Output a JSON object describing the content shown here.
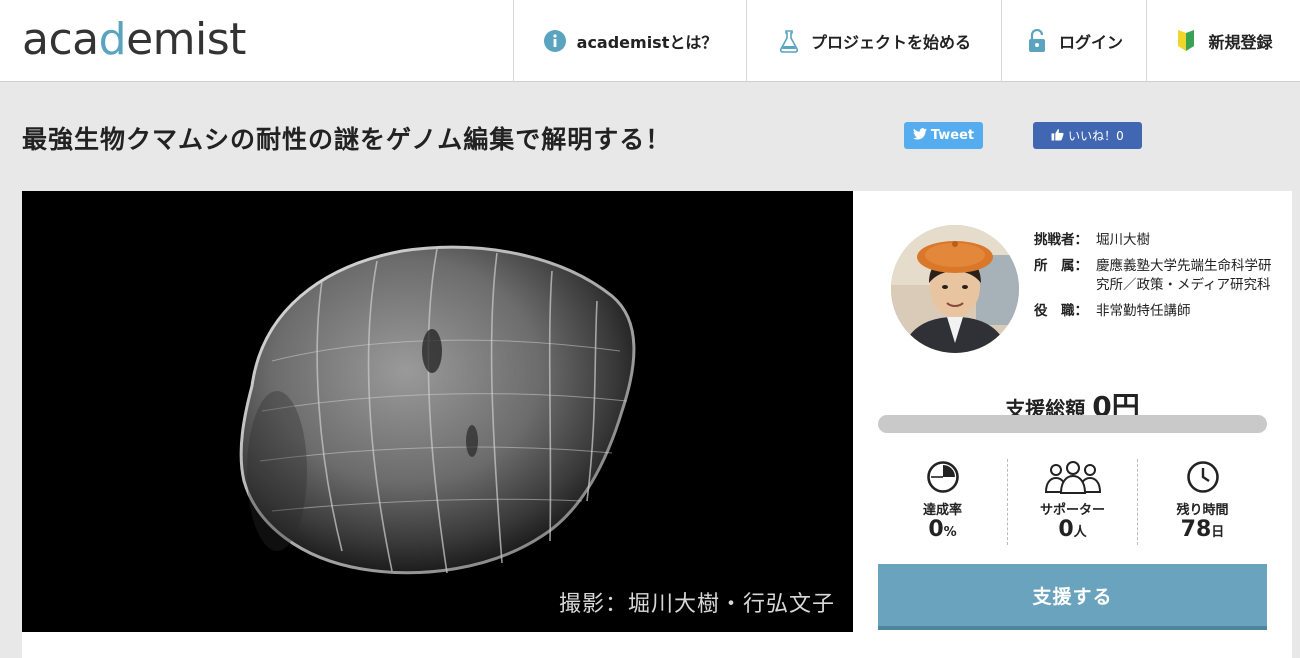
{
  "header": {
    "logo_prefix": "aca",
    "logo_dot": "d",
    "logo_suffix": "emist",
    "nav": [
      {
        "label": "academistとは？",
        "icon": "info-icon"
      },
      {
        "label": "プロジェクトを始める",
        "icon": "flask-icon"
      },
      {
        "label": "ログイン",
        "icon": "lock-icon"
      },
      {
        "label": "新規登録",
        "icon": "beginner-mark-icon"
      }
    ]
  },
  "project": {
    "title": "最強生物クマムシの耐性の謎をゲノム編集で解明する！",
    "image_caption": "撮影：堀川大樹・行弘文子"
  },
  "social": {
    "tweet_label": "Tweet",
    "like_label": "いいね！0"
  },
  "researcher": {
    "rows": [
      {
        "key": "挑戦者：",
        "value": "堀川大樹"
      },
      {
        "key": "所　属：",
        "value": "慶應義塾大学先端生命科学研究所／政策・メディア研究科"
      },
      {
        "key": "役　職：",
        "value": "非常勤特任講師"
      }
    ]
  },
  "funding": {
    "total_label": "支援総額",
    "total_amount": "0円",
    "progress_percent": 0
  },
  "stats": [
    {
      "label": "達成率",
      "value": "0",
      "unit": "%",
      "icon": "pie-chart-icon"
    },
    {
      "label": "サポーター",
      "value": "0",
      "unit": "人",
      "icon": "supporters-icon"
    },
    {
      "label": "残り時間",
      "value": "78",
      "unit": "日",
      "icon": "clock-icon"
    }
  ],
  "support_button": "支援する",
  "colors": {
    "accent": "#6aa3bd",
    "twitter": "#55acee",
    "facebook": "#4267b2"
  }
}
